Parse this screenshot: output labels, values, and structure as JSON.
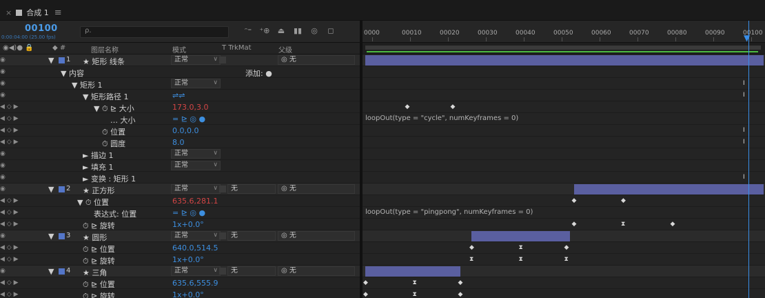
{
  "tab": {
    "close": "×",
    "title": "合成 1",
    "menu": "≡"
  },
  "timecode": {
    "frame": "00100",
    "sub": "0:00:04:00 (25.00 fps)"
  },
  "search": {
    "placeholder": "ρ."
  },
  "switch_icons": [
    "ᵔ⁼",
    "⁺⊕",
    "⏏",
    "▮▮",
    "◎",
    "◻"
  ],
  "columns": {
    "av": "◉◀)● 🔒",
    "label": "◆  #",
    "name": "图层名称",
    "mode": "模式",
    "trkmat": "T  TrkMat",
    "parent": "父级"
  },
  "ruler": [
    "0000",
    "00010",
    "00020",
    "00030",
    "00040",
    "00050",
    "00060",
    "00070",
    "00080",
    "00090",
    "00100"
  ],
  "rows": [
    {
      "type": "layer",
      "num": "1",
      "name": "★ 矩形 线条",
      "mode": "正常",
      "parent": "无",
      "indent": 120
    },
    {
      "type": "group",
      "name": "▼ 内容",
      "extra": "添加: ●",
      "indent": 88
    },
    {
      "type": "group",
      "name": "▼ 矩形 1",
      "mode": "正常",
      "indent": 104
    },
    {
      "type": "group",
      "name": "▼ 矩形路径 1",
      "val": "⇌⇌",
      "indent": 120
    },
    {
      "type": "prop",
      "name": "▼ ⏱ ⊵ 大小",
      "val": "173.0,3.0",
      "red": true,
      "indent": 136
    },
    {
      "type": "prop",
      "name": "… 大小",
      "val": "= ⊵ ◎ ●",
      "indent": 160
    },
    {
      "type": "prop",
      "name": "⏱ 位置",
      "val": "0.0,0.0",
      "indent": 148
    },
    {
      "type": "prop",
      "name": "⏱ 圆度",
      "val": "8.0",
      "indent": 148
    },
    {
      "type": "group",
      "name": "► 描边 1",
      "mode": "正常",
      "indent": 120
    },
    {
      "type": "group",
      "name": "► 填充 1",
      "mode": "正常",
      "indent": 120
    },
    {
      "type": "group",
      "name": "► 变换 : 矩形 1",
      "indent": 120
    },
    {
      "type": "layer",
      "num": "2",
      "name": "★ 正方形",
      "mode": "正常",
      "trk": "无",
      "parent": "无",
      "indent": 120
    },
    {
      "type": "prop",
      "name": "▼ ⏱ 位置",
      "val": "635.6,281.1",
      "red": true,
      "indent": 112
    },
    {
      "type": "prop",
      "name": "表达式: 位置",
      "val": "= ⊵ ◎ ●",
      "indent": 136
    },
    {
      "type": "prop",
      "name": "⏱ ⊵ 旋转",
      "val": "1x+0.0°",
      "indent": 120
    },
    {
      "type": "layer",
      "num": "3",
      "name": "★ 圆形",
      "mode": "正常",
      "trk": "无",
      "parent": "无",
      "indent": 120
    },
    {
      "type": "prop",
      "name": "⏱ ⊵ 位置",
      "val": "640.0,514.5",
      "indent": 120
    },
    {
      "type": "prop",
      "name": "⏱ ⊵ 旋转",
      "val": "1x+0.0°",
      "indent": 120
    },
    {
      "type": "layer",
      "num": "4",
      "name": "★ 三角",
      "mode": "正常",
      "trk": "无",
      "parent": "无",
      "indent": 120
    },
    {
      "type": "prop",
      "name": "⏱ ⊵ 位置",
      "val": "635.6,555.9",
      "indent": 120
    },
    {
      "type": "prop",
      "name": "⏱ ⊵ 旋转",
      "val": "1x+0.0°",
      "indent": 120
    }
  ],
  "expressions": {
    "size": "loopOut(type = \"cycle\", numKeyframes = 0)",
    "position": "loopOut(type = \"pingpong\", numKeyframes = 0)"
  },
  "colors": {
    "accent": "#3a8ee8",
    "layer_bar": "#5a5fa0",
    "label": "#5476c8",
    "work_area": "#4bbb3f"
  }
}
